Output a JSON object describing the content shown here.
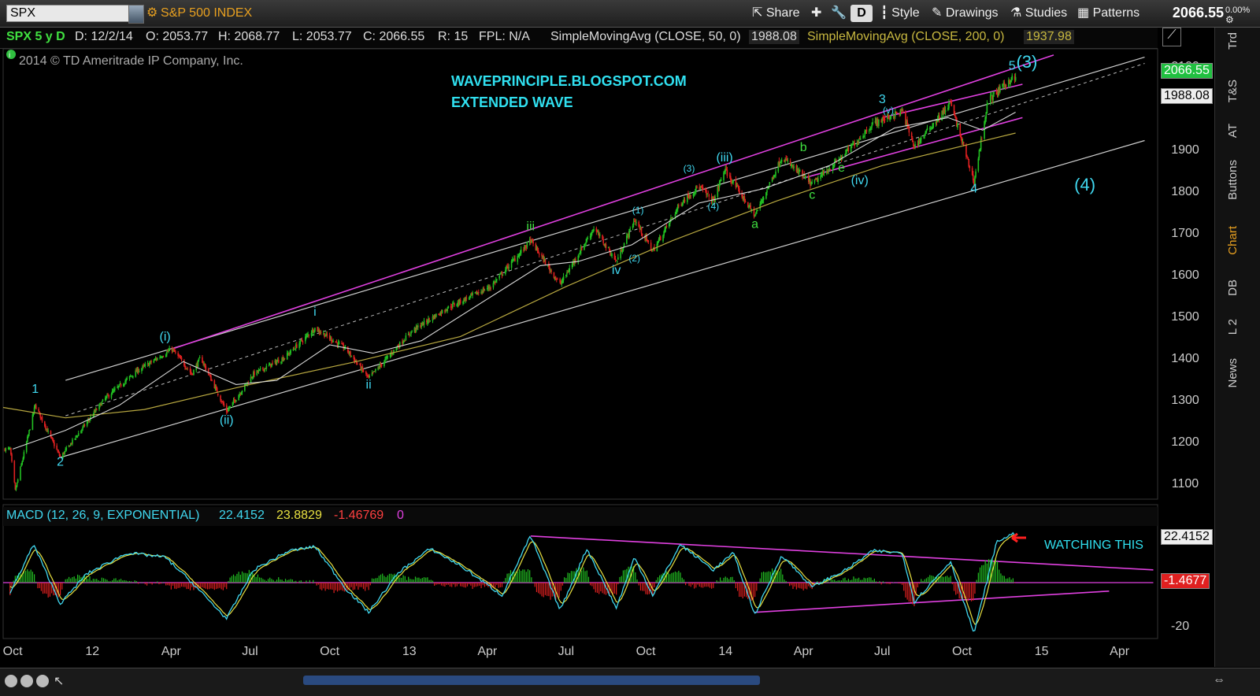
{
  "toolbar": {
    "symbol": "SPX",
    "description": "S&P 500 INDEX",
    "share_label": "Share",
    "period_badge": "D",
    "style_label": "Style",
    "drawings_label": "Drawings",
    "studies_label": "Studies",
    "patterns_label": "Patterns",
    "last_price": "2066.55",
    "zoom": "0.00%"
  },
  "infobar": {
    "title": "SPX 5 y D",
    "date": "D: 12/2/14",
    "open": "O: 2053.77",
    "high": "H: 2068.77",
    "low": "L: 2053.77",
    "close": "C: 2066.55",
    "range": "R: 15",
    "fpl": "FPL: N/A",
    "sma50_label": "SimpleMovingAvg (CLOSE, 50, 0)",
    "sma50_value": "1988.08",
    "sma200_label": "SimpleMovingAvg (CLOSE, 200, 0)",
    "sma200_value": "1937.98"
  },
  "copyright": "2014 © TD Ameritrade IP Company, Inc.",
  "annotations": {
    "site": "WAVEPRINCIPLE.BLOGSPOT.COM",
    "subtitle": "EXTENDED WAVE",
    "watching": "WATCHING THIS"
  },
  "price_boxes": {
    "last": "2066.55",
    "sma50": "1988.08",
    "macd": "22.4152",
    "hist": "-1.4677"
  },
  "macd_info": {
    "label": "MACD (12, 26, 9, EXPONENTIAL)",
    "value": "22.4152",
    "avg": "23.8829",
    "diff": "-1.46769",
    "zero": "0"
  },
  "right_tabs": [
    "Trd",
    "T&S",
    "AT",
    "Buttons",
    "Chart",
    "DB",
    "L 2",
    "News"
  ],
  "colors": {
    "candle_up": "#22c022",
    "candle_down": "#e02020",
    "sma50": "#d8d8d8",
    "sma200": "#b8a840",
    "channel": "#cfcfcf",
    "trendline": "#e040e0",
    "wave_label": "#40d8f0",
    "wave_label_green": "#40e040",
    "macd": "#40d8f0",
    "macd_avg": "#e8e040"
  },
  "chart_data": {
    "type": "candlestick",
    "symbol": "SPX",
    "yaxis_ticks": [
      1100,
      1200,
      1300,
      1400,
      1500,
      1600,
      1700,
      1800,
      1900,
      2100
    ],
    "ylim": [
      1060,
      2140
    ],
    "xaxis_ticks": [
      {
        "label": "Oct",
        "d": "2011-10-01"
      },
      {
        "label": "12",
        "d": "2012-01-01"
      },
      {
        "label": "Apr",
        "d": "2012-04-01"
      },
      {
        "label": "Jul",
        "d": "2012-07-01"
      },
      {
        "label": "Oct",
        "d": "2012-10-01"
      },
      {
        "label": "13",
        "d": "2013-01-01"
      },
      {
        "label": "Apr",
        "d": "2013-04-01"
      },
      {
        "label": "Jul",
        "d": "2013-07-01"
      },
      {
        "label": "Oct",
        "d": "2013-10-01"
      },
      {
        "label": "14",
        "d": "2014-01-01"
      },
      {
        "label": "Apr",
        "d": "2014-04-01"
      },
      {
        "label": "Jul",
        "d": "2014-07-01"
      },
      {
        "label": "Oct",
        "d": "2014-10-01"
      },
      {
        "label": "15",
        "d": "2015-01-01"
      },
      {
        "label": "Apr",
        "d": "2015-04-01"
      }
    ],
    "xlim": [
      "2011-09-20",
      "2015-05-15"
    ],
    "price_path": [
      {
        "d": "2011-09-28",
        "p": 1180
      },
      {
        "d": "2011-10-04",
        "p": 1080
      },
      {
        "d": "2011-10-27",
        "p": 1285
      },
      {
        "d": "2011-11-25",
        "p": 1160
      },
      {
        "d": "2011-12-15",
        "p": 1215
      },
      {
        "d": "2012-01-15",
        "p": 1300
      },
      {
        "d": "2012-02-20",
        "p": 1365
      },
      {
        "d": "2012-04-02",
        "p": 1420
      },
      {
        "d": "2012-04-25",
        "p": 1360
      },
      {
        "d": "2012-05-05",
        "p": 1400
      },
      {
        "d": "2012-06-04",
        "p": 1270
      },
      {
        "d": "2012-07-05",
        "p": 1360
      },
      {
        "d": "2012-08-10",
        "p": 1400
      },
      {
        "d": "2012-09-14",
        "p": 1470
      },
      {
        "d": "2012-10-20",
        "p": 1420
      },
      {
        "d": "2012-11-15",
        "p": 1350
      },
      {
        "d": "2012-12-20",
        "p": 1430
      },
      {
        "d": "2013-01-05",
        "p": 1465
      },
      {
        "d": "2013-02-15",
        "p": 1520
      },
      {
        "d": "2013-04-05",
        "p": 1570
      },
      {
        "d": "2013-05-21",
        "p": 1680
      },
      {
        "d": "2013-06-24",
        "p": 1575
      },
      {
        "d": "2013-08-02",
        "p": 1710
      },
      {
        "d": "2013-08-28",
        "p": 1630
      },
      {
        "d": "2013-09-18",
        "p": 1730
      },
      {
        "d": "2013-10-09",
        "p": 1655
      },
      {
        "d": "2013-11-10",
        "p": 1770
      },
      {
        "d": "2013-12-01",
        "p": 1810
      },
      {
        "d": "2013-12-18",
        "p": 1775
      },
      {
        "d": "2013-12-31",
        "p": 1850
      },
      {
        "d": "2014-02-04",
        "p": 1740
      },
      {
        "d": "2014-03-07",
        "p": 1880
      },
      {
        "d": "2014-04-11",
        "p": 1815
      },
      {
        "d": "2014-05-15",
        "p": 1880
      },
      {
        "d": "2014-06-20",
        "p": 1960
      },
      {
        "d": "2014-07-24",
        "p": 1990
      },
      {
        "d": "2014-08-07",
        "p": 1905
      },
      {
        "d": "2014-09-18",
        "p": 2010
      },
      {
        "d": "2014-10-15",
        "p": 1820
      },
      {
        "d": "2014-10-31",
        "p": 2015
      },
      {
        "d": "2014-11-28",
        "p": 2070
      },
      {
        "d": "2014-12-02",
        "p": 2066
      }
    ],
    "sma50_path": [
      {
        "d": "2011-10-01",
        "p": 1180
      },
      {
        "d": "2011-12-01",
        "p": 1225
      },
      {
        "d": "2012-02-01",
        "p": 1285
      },
      {
        "d": "2012-04-15",
        "p": 1390
      },
      {
        "d": "2012-06-15",
        "p": 1335
      },
      {
        "d": "2012-08-01",
        "p": 1345
      },
      {
        "d": "2012-10-01",
        "p": 1430
      },
      {
        "d": "2012-11-20",
        "p": 1410
      },
      {
        "d": "2013-01-15",
        "p": 1440
      },
      {
        "d": "2013-04-01",
        "p": 1540
      },
      {
        "d": "2013-06-01",
        "p": 1620
      },
      {
        "d": "2013-07-15",
        "p": 1630
      },
      {
        "d": "2013-09-15",
        "p": 1670
      },
      {
        "d": "2013-12-01",
        "p": 1770
      },
      {
        "d": "2014-02-15",
        "p": 1805
      },
      {
        "d": "2014-05-01",
        "p": 1860
      },
      {
        "d": "2014-07-15",
        "p": 1950
      },
      {
        "d": "2014-09-15",
        "p": 1975
      },
      {
        "d": "2014-10-25",
        "p": 1945
      },
      {
        "d": "2014-12-02",
        "p": 1988
      }
    ],
    "sma200_path": [
      {
        "d": "2011-09-20",
        "p": 1280
      },
      {
        "d": "2011-12-01",
        "p": 1255
      },
      {
        "d": "2012-03-01",
        "p": 1275
      },
      {
        "d": "2012-07-01",
        "p": 1335
      },
      {
        "d": "2012-11-01",
        "p": 1390
      },
      {
        "d": "2013-03-01",
        "p": 1450
      },
      {
        "d": "2013-07-01",
        "p": 1570
      },
      {
        "d": "2013-11-01",
        "p": 1680
      },
      {
        "d": "2014-03-01",
        "p": 1775
      },
      {
        "d": "2014-07-01",
        "p": 1860
      },
      {
        "d": "2014-12-02",
        "p": 1938
      }
    ],
    "channel_upper": [
      {
        "d": "2011-12-01",
        "p": 1345
      },
      {
        "d": "2015-04-30",
        "p": 2120
      }
    ],
    "channel_lower": [
      {
        "d": "2011-11-25",
        "p": 1160
      },
      {
        "d": "2015-04-30",
        "p": 1920
      }
    ],
    "channel_mid": [
      {
        "d": "2011-12-01",
        "p": 1260
      },
      {
        "d": "2015-04-30",
        "p": 2105
      }
    ],
    "trendlines": [
      [
        {
          "d": "2012-04-02",
          "p": 1420
        },
        {
          "d": "2015-01-15",
          "p": 2125
        }
      ],
      [
        {
          "d": "2014-04-01",
          "p": 1830
        },
        {
          "d": "2014-12-10",
          "p": 1975
        }
      ],
      [
        {
          "d": "2014-07-01",
          "p": 1975
        },
        {
          "d": "2014-12-10",
          "p": 2055
        }
      ]
    ],
    "wave_labels": [
      {
        "t": "1",
        "d": "2011-10-27",
        "p": 1315,
        "c": "wave_label"
      },
      {
        "t": "2",
        "d": "2011-11-25",
        "p": 1140,
        "c": "wave_label"
      },
      {
        "t": "(i)",
        "d": "2012-03-25",
        "p": 1440,
        "c": "wave_label"
      },
      {
        "t": "(ii)",
        "d": "2012-06-04",
        "p": 1240,
        "c": "wave_label"
      },
      {
        "t": "i",
        "d": "2012-09-14",
        "p": 1500,
        "c": "wave_label"
      },
      {
        "t": "ii",
        "d": "2012-11-15",
        "p": 1325,
        "c": "wave_label"
      },
      {
        "t": "iii",
        "d": "2013-05-21",
        "p": 1705,
        "c": "wave_label_green"
      },
      {
        "t": "iv",
        "d": "2013-08-28",
        "p": 1600,
        "c": "wave_label"
      },
      {
        "t": "(1)",
        "d": "2013-09-22",
        "p": 1745,
        "c": "wave_label",
        "small": true
      },
      {
        "t": "(2)",
        "d": "2013-09-18",
        "p": 1630,
        "c": "wave_label",
        "small": true
      },
      {
        "t": "(3)",
        "d": "2013-11-20",
        "p": 1845,
        "c": "wave_label",
        "small": true
      },
      {
        "t": "(4)",
        "d": "2013-12-18",
        "p": 1755,
        "c": "wave_label",
        "small": true
      },
      {
        "t": "(iii)",
        "d": "2013-12-31",
        "p": 1870,
        "c": "wave_label"
      },
      {
        "t": "a",
        "d": "2014-02-04",
        "p": 1710,
        "c": "wave_label_green"
      },
      {
        "t": "b",
        "d": "2014-04-01",
        "p": 1895,
        "c": "wave_label_green"
      },
      {
        "t": "c",
        "d": "2014-04-11",
        "p": 1780,
        "c": "wave_label_green"
      },
      {
        "t": "e",
        "d": "2014-05-15",
        "p": 1845,
        "c": "wave_label_green"
      },
      {
        "t": "(iv)",
        "d": "2014-06-05",
        "p": 1815,
        "c": "wave_label"
      },
      {
        "t": "3",
        "d": "2014-07-01",
        "p": 2010,
        "c": "wave_label"
      },
      {
        "t": "(v)",
        "d": "2014-07-08",
        "p": 1985,
        "c": "wave_label",
        "small": true
      },
      {
        "t": "4",
        "d": "2014-10-15",
        "p": 1795,
        "c": "wave_label"
      },
      {
        "t": "5",
        "d": "2014-11-28",
        "p": 2090,
        "c": "wave_label"
      },
      {
        "t": "(3)",
        "d": "2014-12-15",
        "p": 2095,
        "c": "wave_label",
        "big": true
      },
      {
        "t": "(4)",
        "d": "2015-02-20",
        "p": 1800,
        "c": "wave_label",
        "big": true
      }
    ],
    "macd": {
      "yaxis_ticks": [
        -20
      ],
      "ylim": [
        -26,
        26
      ],
      "macd_path": [
        {
          "d": "2011-09-28",
          "p": -5
        },
        {
          "d": "2011-10-25",
          "p": 18
        },
        {
          "d": "2011-11-25",
          "p": -10
        },
        {
          "d": "2011-12-25",
          "p": 4
        },
        {
          "d": "2012-02-10",
          "p": 14
        },
        {
          "d": "2012-03-25",
          "p": 12
        },
        {
          "d": "2012-04-25",
          "p": 0
        },
        {
          "d": "2012-06-04",
          "p": -17
        },
        {
          "d": "2012-07-05",
          "p": 6
        },
        {
          "d": "2012-08-15",
          "p": 15
        },
        {
          "d": "2012-09-14",
          "p": 17
        },
        {
          "d": "2012-10-20",
          "p": -3
        },
        {
          "d": "2012-11-15",
          "p": -14
        },
        {
          "d": "2012-12-20",
          "p": 5
        },
        {
          "d": "2013-01-25",
          "p": 16
        },
        {
          "d": "2013-03-01",
          "p": 8
        },
        {
          "d": "2013-04-18",
          "p": -6
        },
        {
          "d": "2013-05-21",
          "p": 22
        },
        {
          "d": "2013-06-24",
          "p": -13
        },
        {
          "d": "2013-07-25",
          "p": 16
        },
        {
          "d": "2013-08-28",
          "p": -12
        },
        {
          "d": "2013-09-18",
          "p": 12
        },
        {
          "d": "2013-10-09",
          "p": -6
        },
        {
          "d": "2013-11-10",
          "p": 18
        },
        {
          "d": "2013-12-18",
          "p": 6
        },
        {
          "d": "2014-01-10",
          "p": 14
        },
        {
          "d": "2014-02-04",
          "p": -15
        },
        {
          "d": "2014-03-07",
          "p": 13
        },
        {
          "d": "2014-04-11",
          "p": -2
        },
        {
          "d": "2014-05-20",
          "p": 6
        },
        {
          "d": "2014-06-20",
          "p": 15
        },
        {
          "d": "2014-07-24",
          "p": 14
        },
        {
          "d": "2014-08-07",
          "p": -9
        },
        {
          "d": "2014-09-18",
          "p": 10
        },
        {
          "d": "2014-10-15",
          "p": -24
        },
        {
          "d": "2014-11-10",
          "p": 19
        },
        {
          "d": "2014-11-28",
          "p": 23
        },
        {
          "d": "2014-12-02",
          "p": 22.4
        }
      ],
      "trendlines": [
        [
          {
            "d": "2013-05-21",
            "p": 22
          },
          {
            "d": "2015-05-10",
            "p": 6
          }
        ],
        [
          {
            "d": "2014-02-04",
            "p": -14
          },
          {
            "d": "2015-03-20",
            "p": -4
          }
        ],
        [
          {
            "d": "2011-09-20",
            "p": 0
          },
          {
            "d": "2015-05-10",
            "p": 0
          }
        ]
      ]
    }
  }
}
